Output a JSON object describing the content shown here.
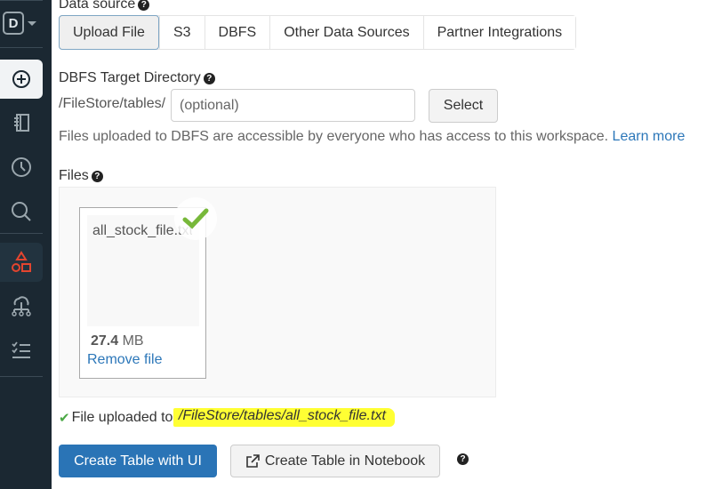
{
  "sidebar": {
    "logo_letter": "D",
    "items": [
      {
        "name": "create",
        "icon": "plus-circle-icon",
        "active": true
      },
      {
        "name": "workspace",
        "icon": "notebook-icon"
      },
      {
        "name": "recents",
        "icon": "clock-icon"
      },
      {
        "name": "search",
        "icon": "search-icon"
      },
      {
        "name": "data",
        "icon": "shapes-icon",
        "active": true,
        "color": "#e3452f"
      },
      {
        "name": "compute",
        "icon": "cloud-cluster-icon"
      },
      {
        "name": "jobs",
        "icon": "checklist-icon"
      }
    ]
  },
  "data_source": {
    "label": "Data source",
    "tabs": [
      {
        "label": "Upload File",
        "active": true
      },
      {
        "label": "S3"
      },
      {
        "label": "DBFS"
      },
      {
        "label": "Other Data Sources"
      },
      {
        "label": "Partner Integrations"
      }
    ]
  },
  "target_dir": {
    "label": "DBFS Target Directory",
    "prefix": "/FileStore/tables/",
    "placeholder": "(optional)",
    "value": "",
    "select_label": "Select",
    "note": "Files uploaded to DBFS are accessible by everyone who has access to this workspace.",
    "learn_more": "Learn more"
  },
  "files": {
    "label": "Files",
    "items": [
      {
        "name": "all_stock_file.txt",
        "size_value": "27.4",
        "size_unit": "MB",
        "remove_label": "Remove file",
        "uploaded": true
      }
    ]
  },
  "status": {
    "text": "File uploaded to",
    "path": "/FileStore/tables/all_stock_file.txt",
    "highlight_color": "#ffff33"
  },
  "actions": {
    "create_ui_label": "Create Table with UI",
    "create_notebook_label": "Create Table in Notebook"
  },
  "colors": {
    "primary": "#2a74b6",
    "link": "#2c77b9",
    "success": "#4aa845",
    "sidebar_bg": "#1b2832"
  }
}
